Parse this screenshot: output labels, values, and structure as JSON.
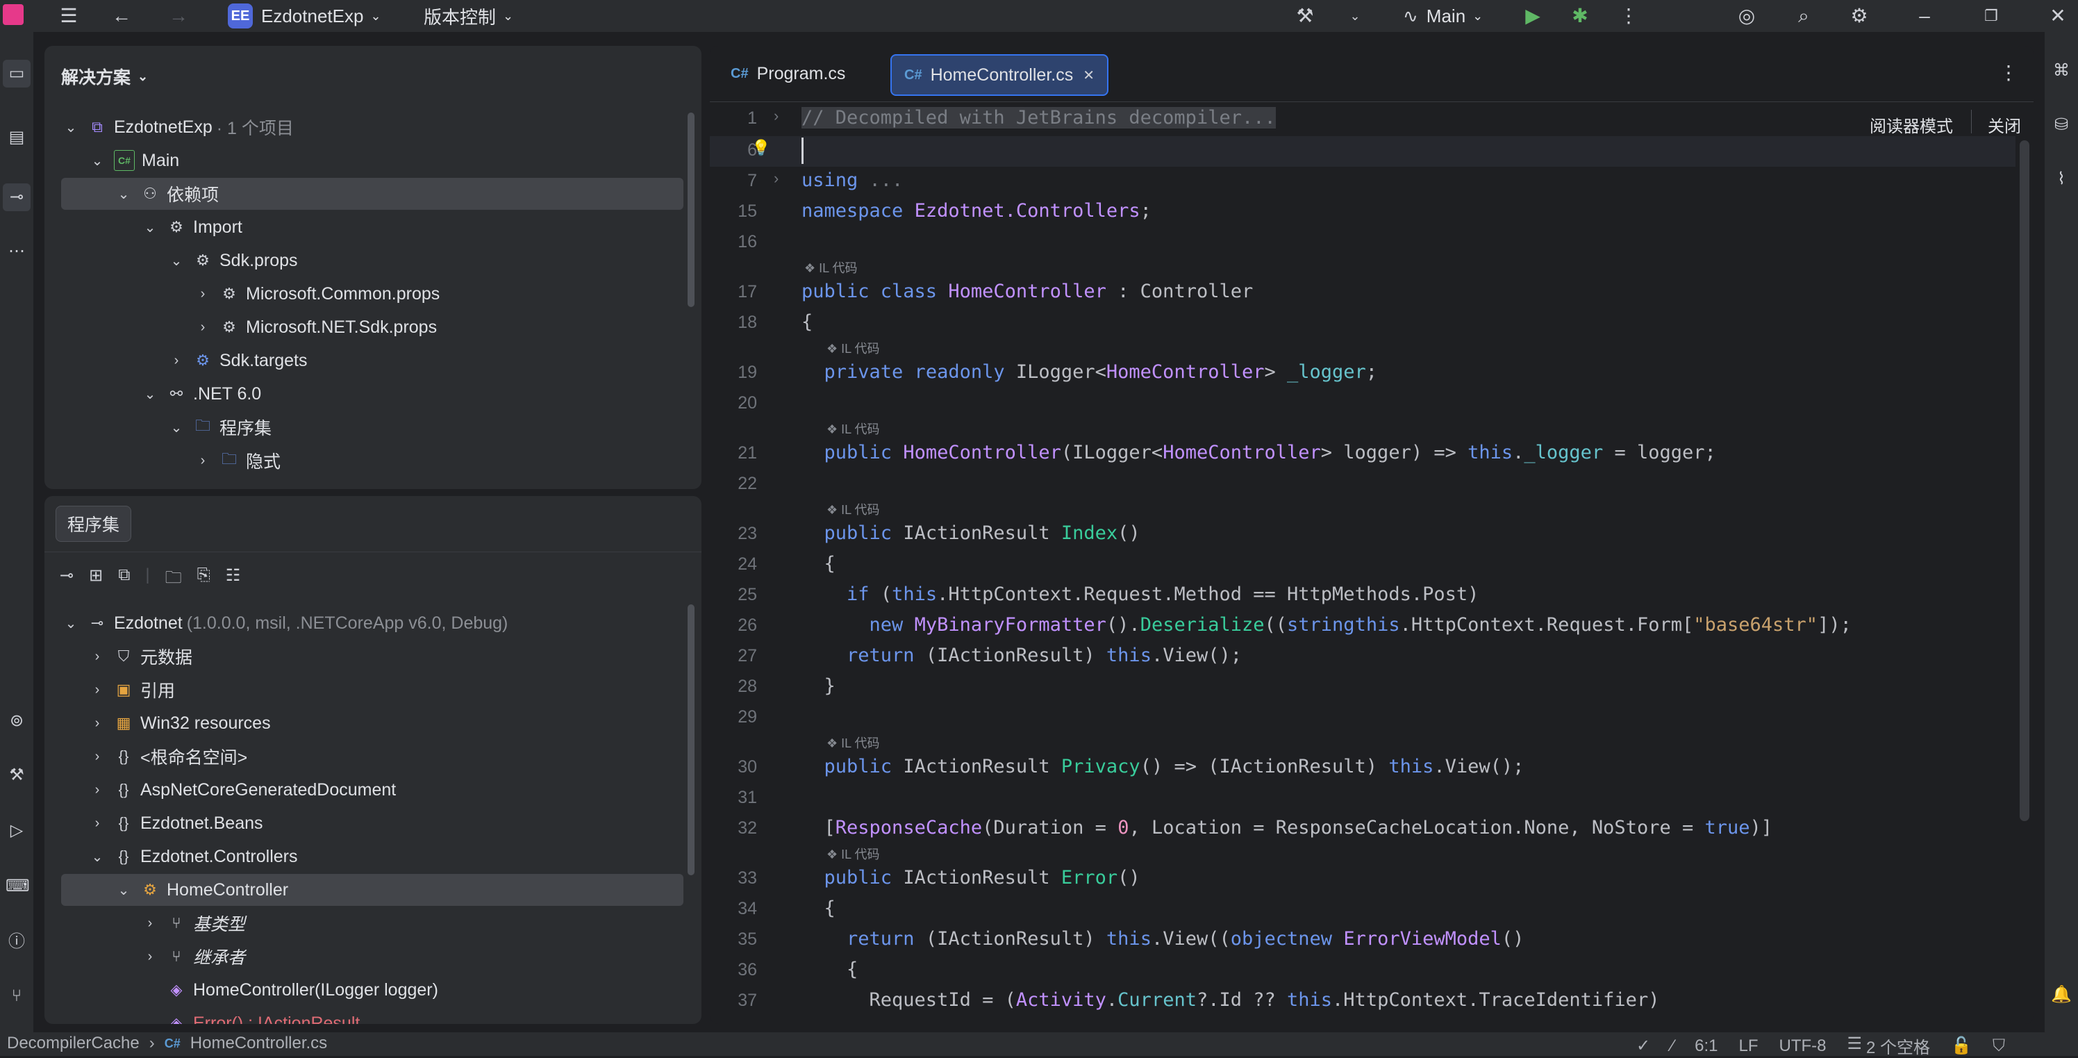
{
  "titlebar": {
    "project_badge": "EE",
    "project_name": "EzdotnetExp",
    "vcs_label": "版本控制",
    "run_config": "Main"
  },
  "solution_panel": {
    "header": "解决方案",
    "rows": [
      {
        "label": "EzdotnetExp",
        "extra": "· 1 个项目"
      },
      {
        "label": "Main"
      },
      {
        "label": "依赖项"
      },
      {
        "label": "Import"
      },
      {
        "label": "Sdk.props"
      },
      {
        "label": "Microsoft.Common.props"
      },
      {
        "label": "Microsoft.NET.Sdk.props"
      },
      {
        "label": "Sdk.targets"
      },
      {
        "label": ".NET 6.0"
      },
      {
        "label": "程序集"
      },
      {
        "label": "隐式"
      }
    ]
  },
  "assembly_panel": {
    "header": "程序集",
    "rows": [
      {
        "label": "Ezdotnet",
        "extra": "(1.0.0.0, msil, .NETCoreApp v6.0, Debug)"
      },
      {
        "label": "元数据"
      },
      {
        "label": "引用"
      },
      {
        "label": "Win32 resources"
      },
      {
        "label": "<根命名空间>"
      },
      {
        "label": "AspNetCoreGeneratedDocument"
      },
      {
        "label": "Ezdotnet.Beans"
      },
      {
        "label": "Ezdotnet.Controllers"
      },
      {
        "label": "HomeController"
      },
      {
        "label": "基类型"
      },
      {
        "label": "继承者"
      },
      {
        "label": "HomeController(ILogger logger)"
      },
      {
        "label": "Error() : IActionResult"
      }
    ]
  },
  "editor": {
    "tabs": [
      {
        "lang": "C#",
        "label": "Program.cs"
      },
      {
        "lang": "C#",
        "label": "HomeController.cs"
      }
    ],
    "reader_mode": "阅读器模式",
    "close_label": "关闭",
    "il_hint": "IL 代码",
    "line_numbers": [
      "1",
      "6",
      "7",
      "15",
      "16",
      "17",
      "18",
      "19",
      "20",
      "21",
      "22",
      "23",
      "24",
      "25",
      "26",
      "27",
      "28",
      "29",
      "30",
      "31",
      "32",
      "33",
      "34",
      "35",
      "36",
      "37"
    ]
  },
  "statusbar": {
    "crumb1": "DecompilerCache",
    "crumb2": "HomeController.cs",
    "position": "6:1",
    "line_sep": "LF",
    "encoding": "UTF-8",
    "indent": "2 个空格"
  },
  "colors": {
    "bg": "#1e1f22",
    "panel": "#2b2d30",
    "keyword": "#6c95eb",
    "type": "#c191ff",
    "method": "#39cc9b",
    "string": "#c9a26d"
  }
}
